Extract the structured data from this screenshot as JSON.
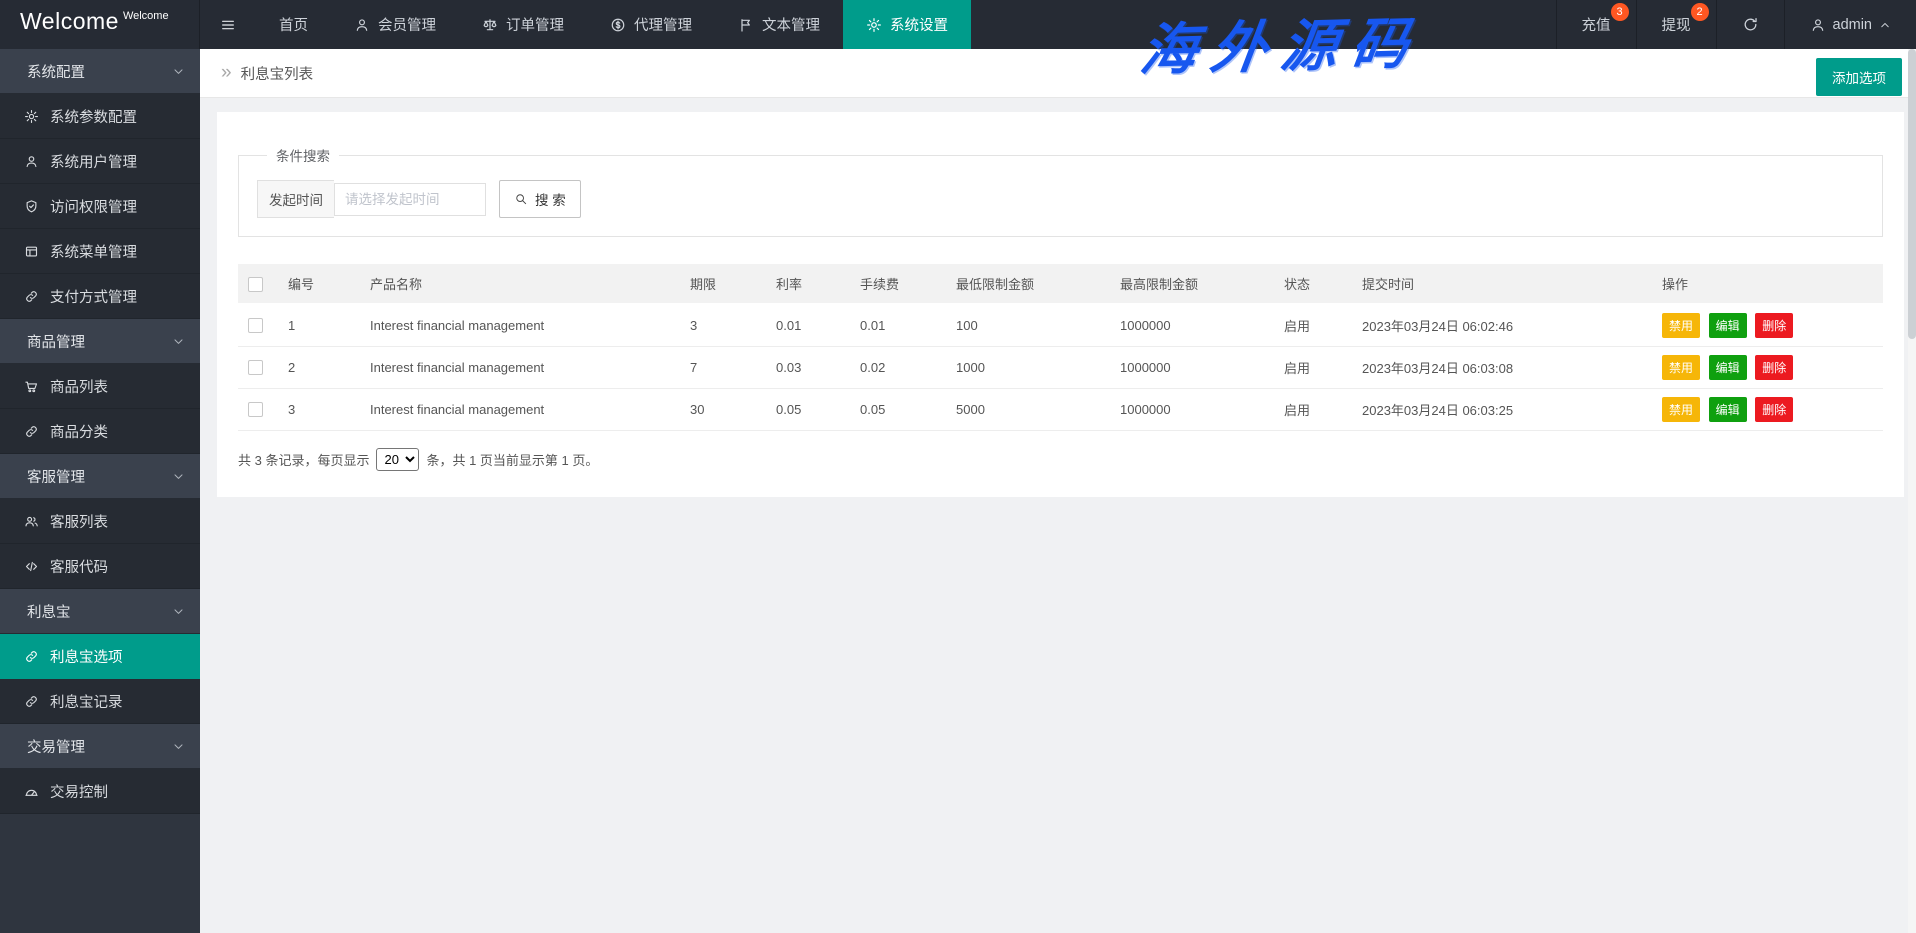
{
  "colors": {
    "accent": "#009c8b",
    "badge": "#ff5722",
    "btn_disable": "#f6b608",
    "btn_edit": "#0fa00f",
    "btn_delete": "#ec1a20",
    "watermark_blue": "#1757ef"
  },
  "topbar": {
    "logo": "Welcome",
    "logo_sup": "Welcome",
    "nav": [
      {
        "label": "首页"
      },
      {
        "label": "会员管理"
      },
      {
        "label": "订单管理"
      },
      {
        "label": "代理管理"
      },
      {
        "label": "文本管理"
      },
      {
        "label": "系统设置",
        "active": true
      }
    ],
    "recharge": {
      "label": "充值",
      "badge": "3"
    },
    "withdraw": {
      "label": "提现",
      "badge": "2"
    },
    "user": {
      "name": "admin"
    }
  },
  "watermark": "海外源码",
  "sidebar": {
    "groups": [
      {
        "label": "系统配置",
        "items": [
          {
            "label": "系统参数配置"
          },
          {
            "label": "系统用户管理"
          },
          {
            "label": "访问权限管理"
          },
          {
            "label": "系统菜单管理"
          },
          {
            "label": "支付方式管理"
          }
        ]
      },
      {
        "label": "商品管理",
        "items": [
          {
            "label": "商品列表"
          },
          {
            "label": "商品分类"
          }
        ]
      },
      {
        "label": "客服管理",
        "items": [
          {
            "label": "客服列表"
          },
          {
            "label": "客服代码"
          }
        ]
      },
      {
        "label": "利息宝",
        "items": [
          {
            "label": "利息宝选项",
            "active": true
          },
          {
            "label": "利息宝记录"
          }
        ]
      },
      {
        "label": "交易管理",
        "items": [
          {
            "label": "交易控制"
          }
        ]
      }
    ]
  },
  "page": {
    "breadcrumb_icon": "»",
    "breadcrumb": "利息宝列表",
    "add_button": "添加选项"
  },
  "search": {
    "legend": "条件搜索",
    "field_label": "发起时间",
    "placeholder": "请选择发起时间",
    "button_label": "搜 索"
  },
  "table": {
    "headers": [
      "编号",
      "产品名称",
      "期限",
      "利率",
      "手续费",
      "最低限制金额",
      "最高限制金额",
      "状态",
      "提交时间",
      "操作"
    ],
    "rows": [
      {
        "id": "1",
        "name": "Interest financial management",
        "term": "3",
        "rate": "0.01",
        "fee": "0.01",
        "min": "100",
        "max": "1000000",
        "status": "启用",
        "time": "2023年03月24日 06:02:46"
      },
      {
        "id": "2",
        "name": "Interest financial management",
        "term": "7",
        "rate": "0.03",
        "fee": "0.02",
        "min": "1000",
        "max": "1000000",
        "status": "启用",
        "time": "2023年03月24日 06:03:08"
      },
      {
        "id": "3",
        "name": "Interest financial management",
        "term": "30",
        "rate": "0.05",
        "fee": "0.05",
        "min": "5000",
        "max": "1000000",
        "status": "启用",
        "time": "2023年03月24日 06:03:25"
      }
    ],
    "actions": {
      "disable": "禁用",
      "edit": "编辑",
      "delete": "删除"
    }
  },
  "pagination": {
    "prefix": "共 3 条记录，每页显示",
    "per_page": "20",
    "suffix": "条，共 1 页当前显示第 1 页。"
  }
}
